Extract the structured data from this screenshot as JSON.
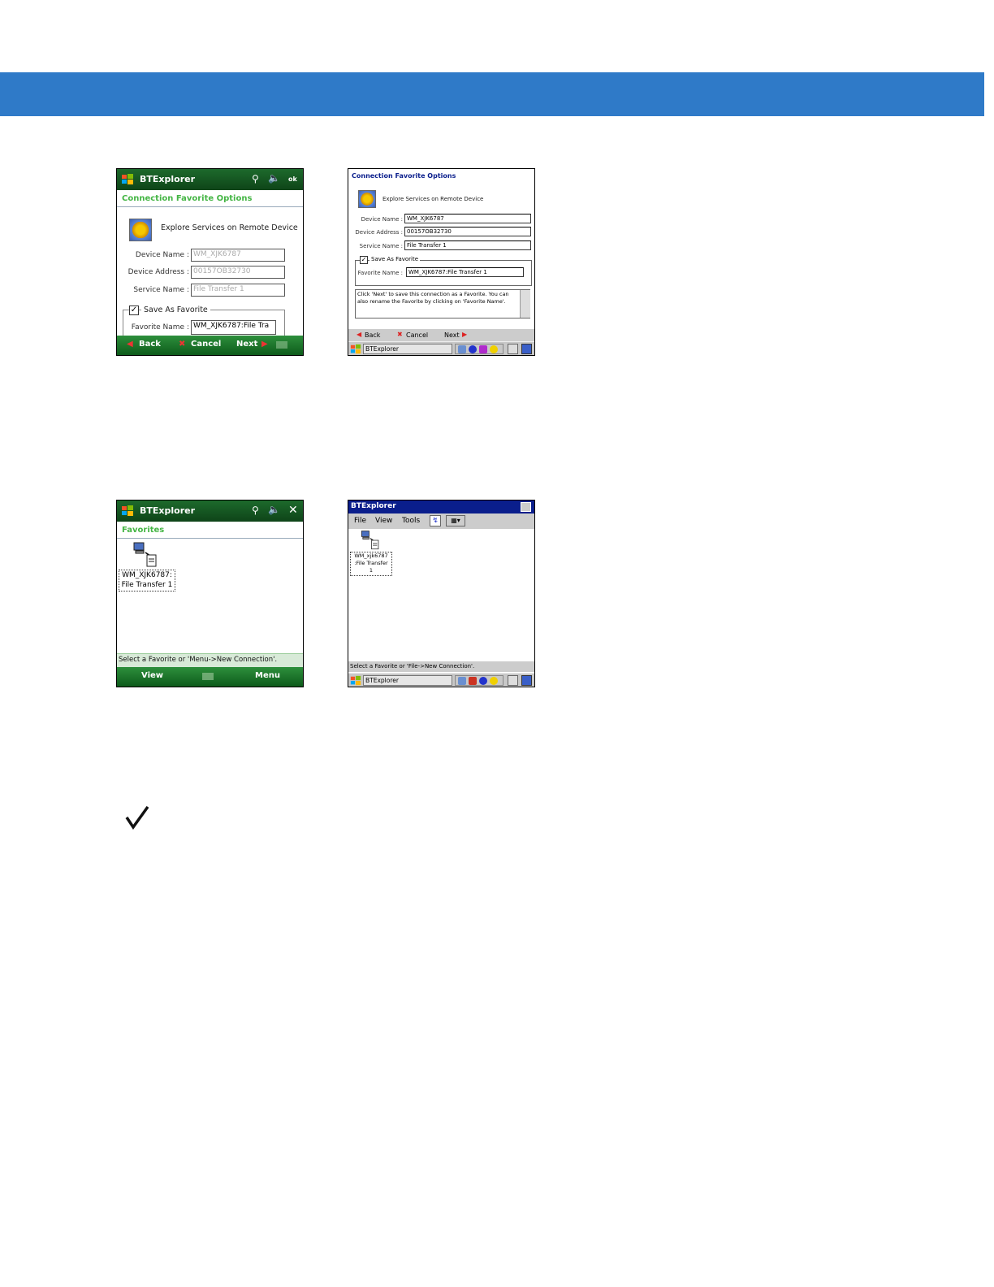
{
  "screens": {
    "wm_options": {
      "title": "BTExplorer",
      "ok": "ok",
      "heading": "Connection Favorite Options",
      "explore": "Explore Services on Remote Device",
      "device_name_label": "Device Name :",
      "device_name": "WM_XJK6787",
      "device_address_label": "Device Address :",
      "device_address": "00157OB32730",
      "service_name_label": "Service Name :",
      "service_name": "File Transfer 1",
      "save_as_favorite": "Save As Favorite",
      "favorite_name_label": "Favorite Name :",
      "favorite_name": "WM_XJK6787:File Tra",
      "back": "Back",
      "cancel": "Cancel",
      "next": "Next"
    },
    "ce_options": {
      "heading": "Connection Favorite Options",
      "explore": "Explore Services on Remote Device",
      "device_name_label": "Device Name :",
      "device_name": "WM_XJK6787",
      "device_address_label": "Device Address :",
      "device_address": "00157OB32730",
      "service_name_label": "Service Name :",
      "service_name": "File Transfer 1",
      "save_as_favorite": "Save As Favorite",
      "favorite_name_label": "Favorite Name :",
      "favorite_name": "WM_XJK6787:File Transfer 1",
      "help_text": "Click 'Next' to save this connection as a Favorite. You can also rename the Favorite by clicking on 'Favorite Name'.",
      "back": "Back",
      "cancel": "Cancel",
      "next": "Next",
      "taskbar_app": "BTExplorer"
    },
    "wm_favorites": {
      "title": "BTExplorer",
      "heading": "Favorites",
      "item_line1": "WM_XJK6787:",
      "item_line2": "File Transfer 1",
      "status": "Select a Favorite or 'Menu->New Connection'.",
      "view": "View",
      "menu": "Menu"
    },
    "ce_favorites": {
      "title": "BTExplorer",
      "menu_file": "File",
      "menu_view": "View",
      "menu_tools": "Tools",
      "item_line1": "WM_xjk6787",
      "item_line2": ":File Transfer",
      "item_line3": "1",
      "status": "Select a Favorite or 'File->New Connection'.",
      "taskbar_app": "BTExplorer"
    }
  },
  "note_icon": "checkmark-icon",
  "colors": {
    "banner": "#2f7ac8",
    "wm_green": "#0e4418",
    "wm_heading": "#44b544",
    "ce_title": "#0a1e8c"
  }
}
